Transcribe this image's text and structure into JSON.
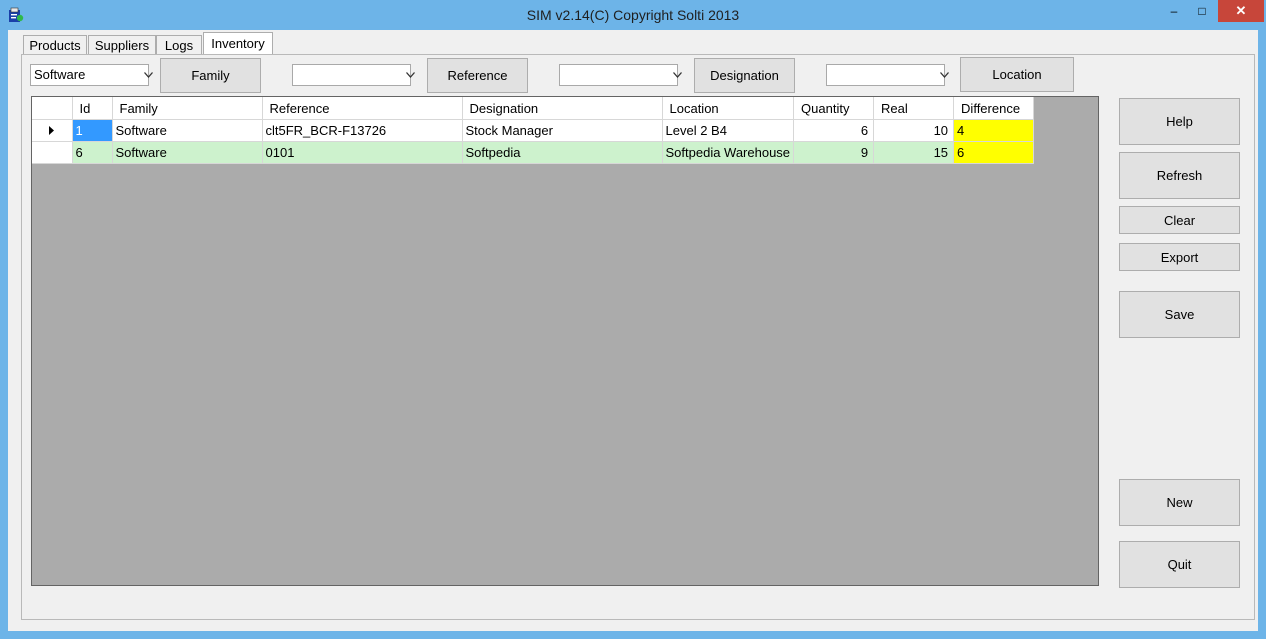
{
  "window": {
    "title": "SIM v2.14(C) Copyright Solti 2013",
    "controls": {
      "minimize": "–",
      "maximize": "□",
      "close": "✕"
    },
    "icon": "app-icon"
  },
  "tabs": [
    {
      "label": "Products",
      "active": false
    },
    {
      "label": "Suppliers",
      "active": false
    },
    {
      "label": "Logs",
      "active": false
    },
    {
      "label": "Inventory",
      "active": true
    }
  ],
  "filters": {
    "family_value": "Software",
    "family_button": "Family",
    "reference_value": "",
    "reference_button": "Reference",
    "designation_value": "",
    "designation_button": "Designation",
    "location_value": "",
    "location_button": "Location"
  },
  "grid": {
    "columns": [
      "Id",
      "Family",
      "Reference",
      "Designation",
      "Location",
      "Quantity",
      "Real",
      "Difference"
    ],
    "rows": [
      {
        "current": true,
        "id": "1",
        "family": "Software",
        "reference": "clt5FR_BCR-F13726",
        "designation": "Stock Manager",
        "location": "Level 2 B4",
        "quantity": "6",
        "real": "10",
        "difference": "4"
      },
      {
        "current": false,
        "id": "6",
        "family": "Software",
        "reference": "0101",
        "designation": "Softpedia",
        "location": "Softpedia Warehouse",
        "quantity": "9",
        "real": "15",
        "difference": "6"
      }
    ],
    "row_marker_icon": "current-row-arrow-icon"
  },
  "side_buttons": {
    "help": "Help",
    "refresh": "Refresh",
    "clear": "Clear",
    "export": "Export",
    "save": "Save",
    "new": "New",
    "quit": "Quit"
  },
  "colors": {
    "alt_row": "#cdf2cd",
    "difference": "#ffff00",
    "selection": "#3399ff",
    "grid_background": "#ababab"
  }
}
